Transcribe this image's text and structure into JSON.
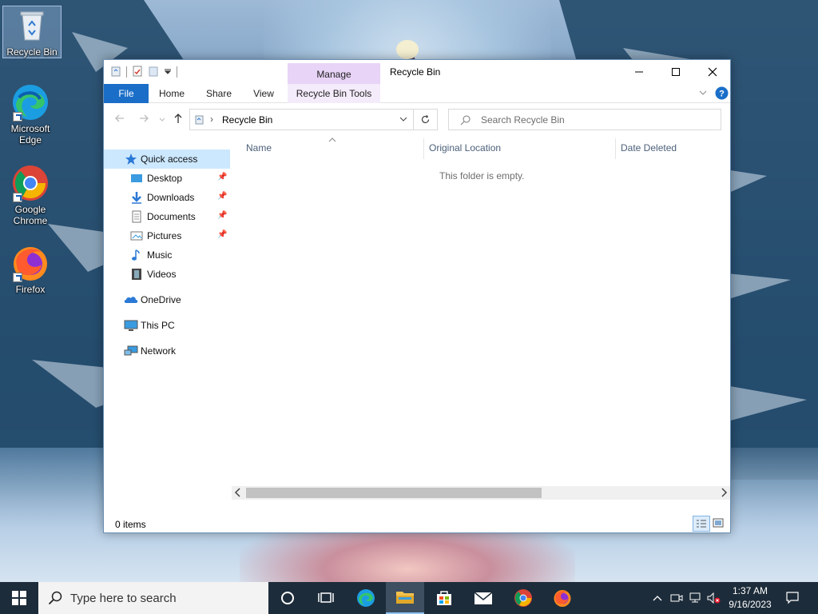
{
  "desktop": {
    "icons": [
      {
        "label": "Recycle Bin",
        "selected": true
      },
      {
        "label": "Microsoft Edge"
      },
      {
        "label": "Google Chrome"
      },
      {
        "label": "Firefox"
      }
    ]
  },
  "window": {
    "title": "Recycle Bin",
    "contextual_tab_group": "Manage",
    "ribbon_tabs": [
      "File",
      "Home",
      "Share",
      "View",
      "Recycle Bin Tools"
    ],
    "address": {
      "crumb": "Recycle Bin"
    },
    "search": {
      "placeholder": "Search Recycle Bin"
    },
    "nav_pane": {
      "quick_access": "Quick access",
      "pinned": [
        "Desktop",
        "Downloads",
        "Documents",
        "Pictures"
      ],
      "unpinned": [
        "Music",
        "Videos"
      ],
      "onedrive": "OneDrive",
      "this_pc": "This PC",
      "network": "Network"
    },
    "columns": [
      "Name",
      "Original Location",
      "Date Deleted"
    ],
    "empty_message": "This folder is empty.",
    "status": "0 items"
  },
  "taskbar": {
    "search_placeholder": "Type here to search",
    "time": "1:37 AM",
    "date": "9/16/2023"
  },
  "colors": {
    "accent": "#1a6ec8",
    "selection": "#cce8ff",
    "tool_tab": "#e8d4f7",
    "taskbar": "#1d2c3a"
  }
}
